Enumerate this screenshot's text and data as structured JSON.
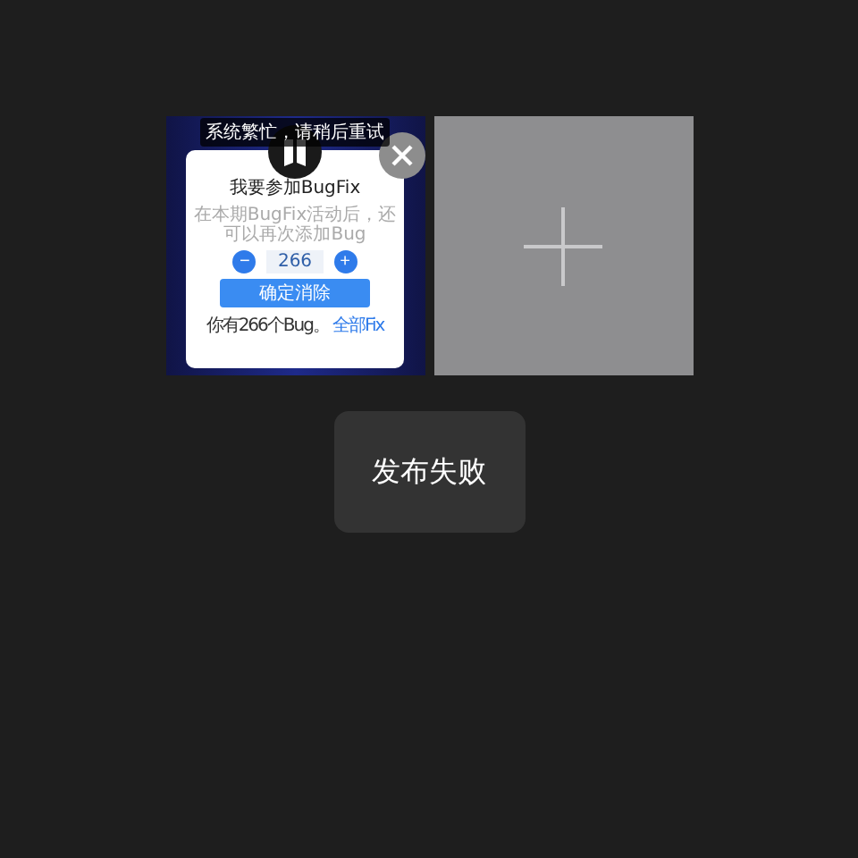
{
  "preview": {
    "toast": "系统繁忙，请稍后重试",
    "dialog": {
      "title": "我要参加BugFix",
      "subtitle": "在本期BugFix活动后，还可以再次添加Bug",
      "minus": "−",
      "count": "266",
      "plus": "+",
      "button": "确定消除",
      "footer": "你有266个Bug。",
      "footer_link": "全部Fix"
    }
  },
  "toast": "发布失败"
}
